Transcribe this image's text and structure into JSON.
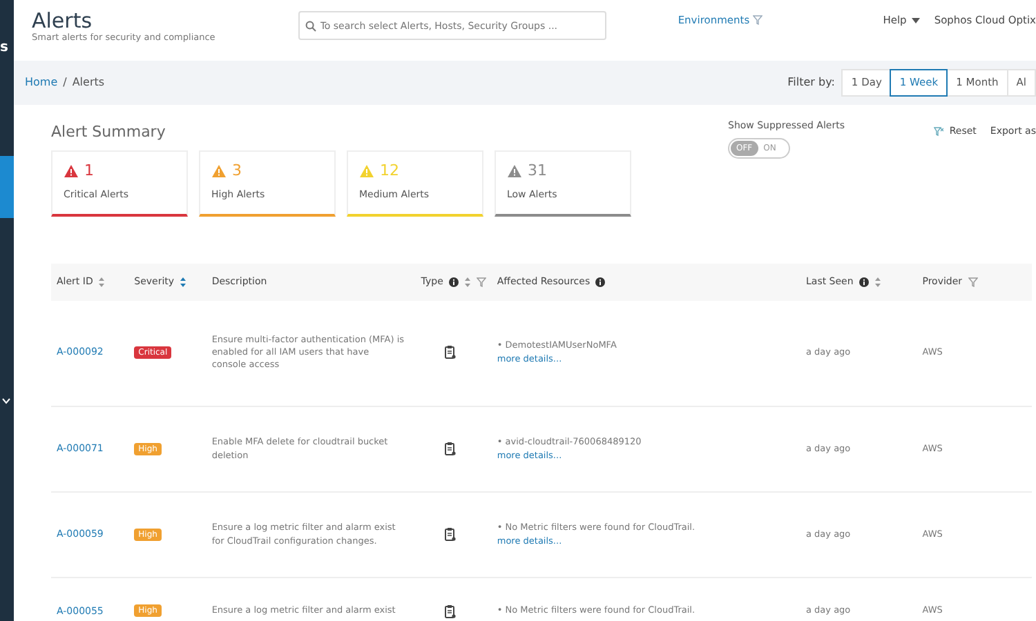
{
  "sidebar": {
    "text": "s"
  },
  "header": {
    "title": "Alerts",
    "subtitle": "Smart alerts for security and compliance",
    "search": {
      "placeholder": "To search select Alerts, Hosts, Security Groups ..."
    },
    "environments": "Environments",
    "help": "Help",
    "user": "Sophos Cloud Optix"
  },
  "breadcrumb": [
    {
      "label": "Home",
      "kind": "link"
    },
    {
      "label": "/",
      "kind": "separator"
    },
    {
      "label": "Alerts",
      "kind": "current"
    }
  ],
  "filter": {
    "label": "Filter by:",
    "options": [
      {
        "label": "1 Day",
        "selected": false
      },
      {
        "label": "1 Week",
        "selected": true
      },
      {
        "label": "1 Month",
        "selected": false
      },
      {
        "label": "Al",
        "selected": false
      }
    ]
  },
  "summary": {
    "title": "Alert Summary",
    "cards": [
      {
        "count": "1",
        "label": "Critical Alerts",
        "color": "#d9363e"
      },
      {
        "count": "3",
        "label": "High Alerts",
        "color": "#f0a030"
      },
      {
        "count": "12",
        "label": "Medium Alerts",
        "color": "#f2d22e"
      },
      {
        "count": "31",
        "label": "Low Alerts",
        "color": "#8c8c8c"
      }
    ]
  },
  "suppressed": {
    "label": "Show Suppressed Alerts",
    "off_label": "OFF",
    "on_label": "ON",
    "on": false
  },
  "actions": {
    "reset": "Reset",
    "export": "Export as"
  },
  "table": {
    "columns": [
      {
        "label": "Alert ID",
        "icons": [
          {
            "kind": "sort",
            "active": false
          }
        ]
      },
      {
        "label": "Severity",
        "icons": [
          {
            "kind": "sort",
            "active": true
          }
        ]
      },
      {
        "label": "Description"
      },
      {
        "label": "Type",
        "icons": [
          {
            "kind": "info"
          },
          {
            "kind": "sort",
            "active": false
          },
          {
            "kind": "filter"
          }
        ]
      },
      {
        "label": "Affected Resources",
        "icons": [
          {
            "kind": "info"
          }
        ]
      },
      {
        "label": "Last Seen",
        "icons": [
          {
            "kind": "info"
          },
          {
            "kind": "sort",
            "active": false
          }
        ]
      },
      {
        "label": "Provider",
        "icons": [
          {
            "kind": "filter"
          }
        ]
      }
    ],
    "rows": [
      {
        "id": "A-000092",
        "severity": {
          "label": "Critical",
          "kind": "critical"
        },
        "description": "Ensure multi-factor authentication (MFA) is enabled for all IAM users that have console access",
        "resource": "• DemotestIAMUserNoMFA",
        "more": "more details...",
        "last_seen": "a day ago",
        "provider": "AWS"
      },
      {
        "id": "A-000071",
        "severity": {
          "label": "High",
          "kind": "high"
        },
        "description": "Enable MFA delete for cloudtrail bucket deletion",
        "resource": "• avid-cloudtrail-760068489120",
        "more": "more details...",
        "last_seen": "a day ago",
        "provider": "AWS"
      },
      {
        "id": "A-000059",
        "severity": {
          "label": "High",
          "kind": "high"
        },
        "description": "Ensure a log metric filter and alarm exist for CloudTrail configuration changes.",
        "resource": "• No Metric filters were found for CloudTrail.",
        "more": "more details...",
        "last_seen": "a day ago",
        "provider": "AWS"
      },
      {
        "id": "A-000055",
        "severity": {
          "label": "High",
          "kind": "high"
        },
        "description": "Ensure a log metric filter and alarm exist",
        "resource": "• No Metric filters were found for CloudTrail.",
        "last_seen": "a day ago",
        "provider": "AWS"
      }
    ]
  }
}
